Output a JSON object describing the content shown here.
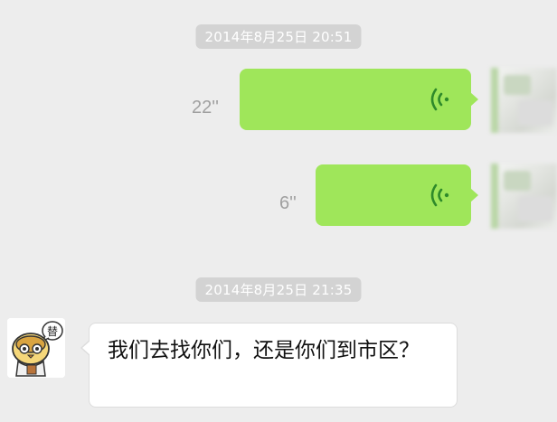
{
  "chat": {
    "timestamps": [
      "2014年8月25日 20:51",
      "2014年8月25日 21:35"
    ],
    "voice_messages": [
      {
        "duration": "22''"
      },
      {
        "duration": "6''"
      }
    ],
    "received_message": {
      "text": "我们去找你们，还是你们到市区？",
      "avatar_badge": "替"
    }
  },
  "colors": {
    "background": "#ededed",
    "sent_bubble": "#9fe65a",
    "voice_icon": "#2e8a2a",
    "timestamp_bg": "#d3d3d3",
    "received_bubble": "#ffffff"
  },
  "icons": {
    "voice": "voice-wave-icon"
  }
}
